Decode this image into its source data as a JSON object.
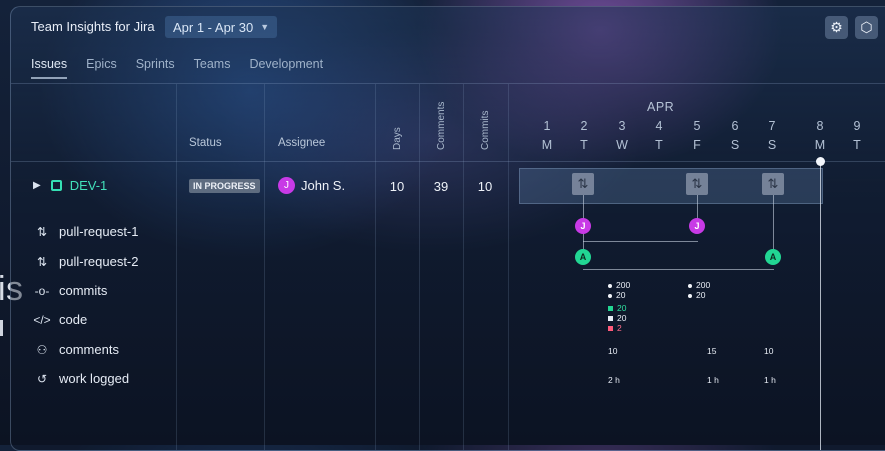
{
  "app": {
    "title": "Team Insights for Jira",
    "date_range": "Apr 1 - Apr 30"
  },
  "tabs": [
    "Issues",
    "Epics",
    "Sprints",
    "Teams",
    "Development"
  ],
  "background_text": "is",
  "columns": {
    "status": "Status",
    "assignee": "Assignee",
    "days": "Days",
    "comments": "Comments",
    "commits": "Commits"
  },
  "calendar": {
    "month": "APR",
    "days": [
      {
        "num": "1",
        "letter": "M"
      },
      {
        "num": "2",
        "letter": "T"
      },
      {
        "num": "3",
        "letter": "W"
      },
      {
        "num": "4",
        "letter": "T"
      },
      {
        "num": "5",
        "letter": "F"
      },
      {
        "num": "6",
        "letter": "S"
      },
      {
        "num": "7",
        "letter": "S"
      },
      {
        "num": "8",
        "letter": "M"
      },
      {
        "num": "9",
        "letter": "T"
      }
    ]
  },
  "issue": {
    "key": "DEV-1",
    "status": "IN PROGRESS",
    "assignee": "John S.",
    "assignee_initial": "J",
    "days": "10",
    "comments": "39",
    "commits": "10"
  },
  "subrows": [
    "pull-request-1",
    "pull-request-2",
    "commits",
    "code",
    "comments",
    "work logged"
  ],
  "nodes": {
    "j": "J",
    "a": "A"
  },
  "code_stats": {
    "day2": {
      "line1": "200",
      "line2": "20",
      "added": "20",
      "modified": "20",
      "removed": "2"
    },
    "day5": {
      "line1": "200",
      "line2": "20"
    }
  },
  "comments_row": {
    "day2": "10",
    "day5": "15",
    "day7": "10"
  },
  "work_row": {
    "day2": "2 h",
    "day5": "1 h",
    "day7": "1 h"
  },
  "colors": {
    "accent_green": "#22d693",
    "avatar_purple": "#c83ae6",
    "removed_red": "#ff5a7a"
  }
}
